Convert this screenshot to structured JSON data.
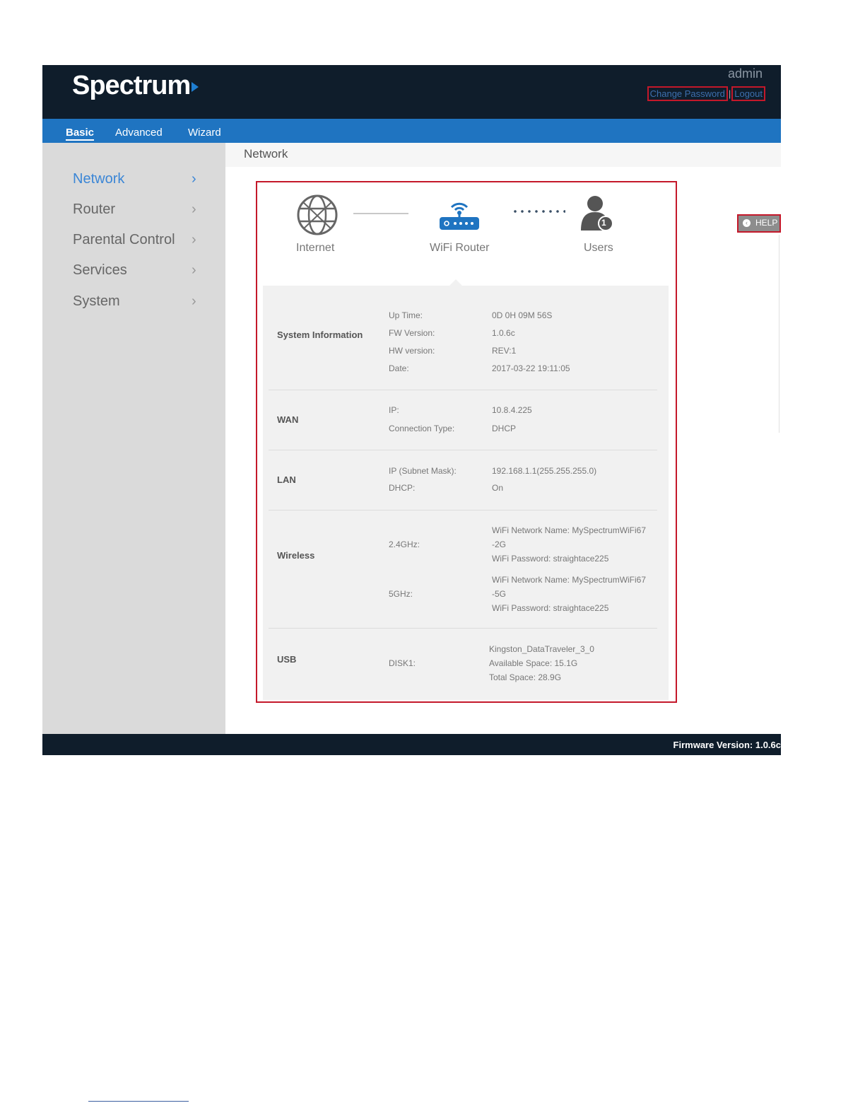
{
  "header": {
    "logo": "Spectrum",
    "user": "admin",
    "change_password": "Change Password",
    "separator": "|",
    "logout": "Logout"
  },
  "nav": {
    "tabs": [
      {
        "label": "Basic",
        "active": true
      },
      {
        "label": "Advanced",
        "active": false
      },
      {
        "label": "Wizard",
        "active": false
      }
    ]
  },
  "sidebar": {
    "items": [
      {
        "label": "Network",
        "active": true
      },
      {
        "label": "Router",
        "active": false
      },
      {
        "label": "Parental Control",
        "active": false
      },
      {
        "label": "Services",
        "active": false
      },
      {
        "label": "System",
        "active": false
      }
    ]
  },
  "breadcrumb": "Network",
  "topology": {
    "internet": "Internet",
    "router": "WiFi Router",
    "users": "Users",
    "user_count": "1"
  },
  "sections": {
    "system": {
      "title": "System Information",
      "rows": [
        {
          "key": "Up Time:",
          "value": "0D 0H 09M 56S"
        },
        {
          "key": "FW Version:",
          "value": "1.0.6c"
        },
        {
          "key": "HW version:",
          "value": "REV:1"
        },
        {
          "key": "Date:",
          "value": "2017-03-22 19:11:05"
        }
      ]
    },
    "wan": {
      "title": "WAN",
      "rows": [
        {
          "key": "IP:",
          "value": "10.8.4.225"
        },
        {
          "key": "Connection Type:",
          "value": "DHCP"
        }
      ]
    },
    "lan": {
      "title": "LAN",
      "rows": [
        {
          "key": "IP (Subnet Mask):",
          "value": "192.168.1.1(255.255.255.0)"
        },
        {
          "key": "DHCP:",
          "value": "On"
        }
      ]
    },
    "wireless": {
      "title": "Wireless",
      "band24": {
        "key": "2.4GHz:",
        "lines": [
          "WiFi Network Name: MySpectrumWiFi67",
          "-2G",
          "WiFi Password: straightace225"
        ]
      },
      "band5": {
        "key": "5GHz:",
        "lines": [
          "WiFi Network Name: MySpectrumWiFi67",
          "-5G",
          "WiFi Password: straightace225"
        ]
      }
    },
    "usb": {
      "title": "USB",
      "key": "DISK1:",
      "lines": [
        "Kingston_DataTraveler_3_0",
        "Available Space: 15.1G",
        "Total Space: 28.9G"
      ]
    }
  },
  "help": "HELP",
  "footer": "Firmware Version: 1.0.6c",
  "colors": {
    "header": "#0f1d2b",
    "nav": "#1f74c1",
    "accent": "#3b86d6",
    "highlight": "#c4182a"
  }
}
